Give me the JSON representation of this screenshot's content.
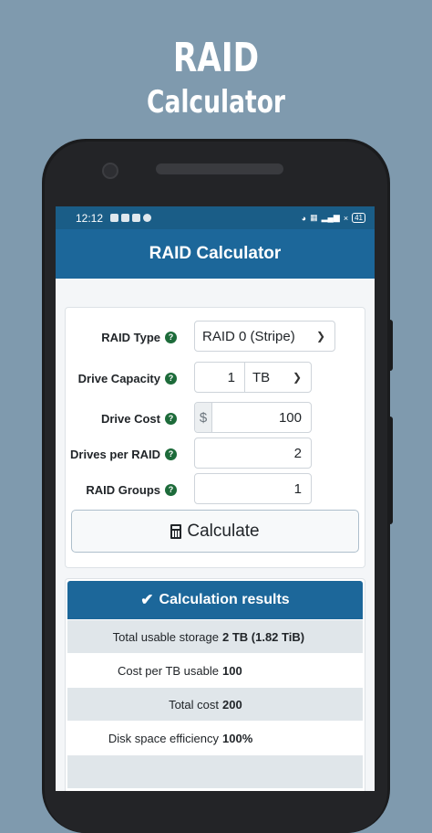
{
  "promo": {
    "title_line1": "RAID",
    "title_line2": "Calculator"
  },
  "statusbar": {
    "time": "12:12",
    "network": "×",
    "battery": "41"
  },
  "app": {
    "title": "RAID Calculator"
  },
  "form": {
    "help_glyph": "?",
    "raid_type": {
      "label": "RAID Type",
      "value": "RAID 0 (Stripe)"
    },
    "drive_capacity": {
      "label": "Drive Capacity",
      "value": "1",
      "unit": "TB"
    },
    "drive_cost": {
      "label": "Drive Cost",
      "currency": "$",
      "value": "100"
    },
    "drives_per_raid": {
      "label": "Drives per RAID",
      "value": "2"
    },
    "raid_groups": {
      "label": "RAID Groups",
      "value": "1"
    },
    "calculate_label": "Calculate"
  },
  "results": {
    "heading": "Calculation results",
    "rows": [
      {
        "key": "Total usable storage",
        "value": "2 TB (1.82 TiB)"
      },
      {
        "key": "Cost per TB usable",
        "value": "100"
      },
      {
        "key": "Total cost",
        "value": "200"
      },
      {
        "key": "Disk space efficiency",
        "value": "100%"
      }
    ]
  },
  "colors": {
    "primary": "#1c679a",
    "statusbar": "#1a5d87",
    "background": "#7f9aae",
    "help_badge": "#1d6b3a"
  }
}
